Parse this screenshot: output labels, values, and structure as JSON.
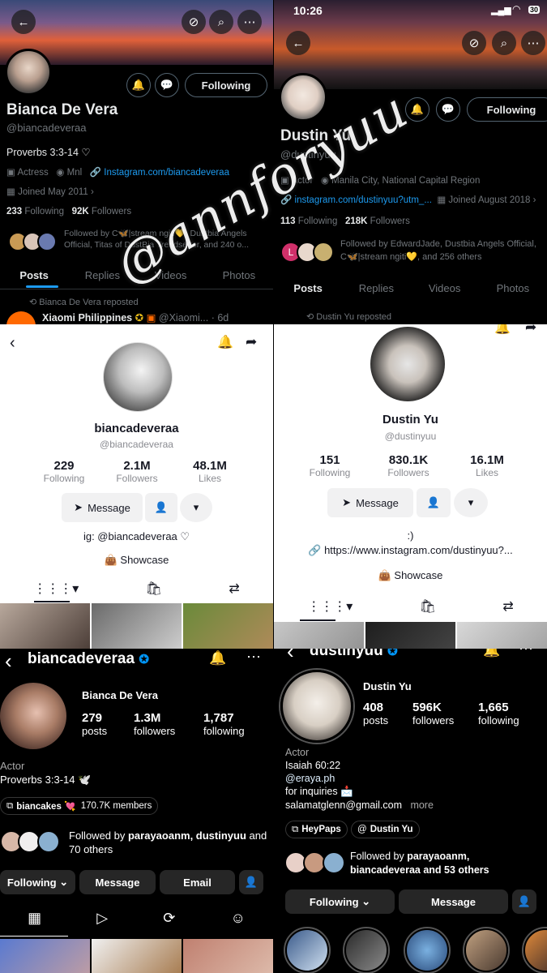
{
  "colors": {
    "x_link": "#1d9bf0",
    "tk_showcase": "#fe2c55",
    "ig_verified": "#0095f6"
  },
  "p1": {
    "back_icon": "arrow-left-icon",
    "following_label": "Following",
    "name": "Bianca De Vera",
    "handle": "@biancadeveraa",
    "bio": "Proverbs 3:3-14 ♡",
    "occupation": "Actress",
    "location": "Mnl",
    "link": "Instagram.com/biancadeveraa",
    "joined": "Joined May 2011",
    "following_count": "233",
    "following_label2": "Following",
    "followers_count": "92K",
    "followers_label": "Followers",
    "followed_by": "Followed by C🦋|stream ngiti💛, Dustbia Angels Official, Titas of DustBia Trendsetter, and 240 o...",
    "tabs": [
      "Posts",
      "Replies",
      "Videos",
      "Photos"
    ],
    "repost_line": "Bianca De Vera reposted",
    "post_author": "Xiaomi Philippines",
    "post_handle": "@Xiaomi...",
    "post_time": "· 6d"
  },
  "p2": {
    "time": "10:26",
    "battery": "30",
    "following_label": "Following",
    "name": "Dustin Yu",
    "handle": "@dustinyuu",
    "occupation": "Actor",
    "location": "Manila City, National Capital Region",
    "link": "instagram.com/dustinyuu?utm_...",
    "joined": "Joined August 2018",
    "following_count": "113",
    "following_label2": "Following",
    "followers_count": "218K",
    "followers_label": "Followers",
    "followed_by": "Followed by EdwardJade, Dustbia Angels Official, C🦋|stream ngiti💛, and 256 others",
    "tabs": [
      "Posts",
      "Replies",
      "Videos",
      "Photos"
    ],
    "repost_line": "Dustin Yu reposted"
  },
  "p3": {
    "username": "biancadeveraa",
    "handle": "@biancadeveraa",
    "stats": [
      {
        "n": "229",
        "l": "Following"
      },
      {
        "n": "2.1M",
        "l": "Followers"
      },
      {
        "n": "48.1M",
        "l": "Likes"
      }
    ],
    "message_label": "Message",
    "bio": "ig: @biancadeveraa ♡",
    "showcase": "Showcase"
  },
  "p4": {
    "name": "Dustin Yu",
    "handle": "@dustinyuu",
    "stats": [
      {
        "n": "151",
        "l": "Following"
      },
      {
        "n": "830.1K",
        "l": "Followers"
      },
      {
        "n": "16.1M",
        "l": "Likes"
      }
    ],
    "message_label": "Message",
    "bio": ":)",
    "link": "https://www.instagram.com/dustinyuu?...",
    "showcase": "Showcase"
  },
  "p5": {
    "username": "biancadeveraa",
    "full_name": "Bianca De Vera",
    "stats": [
      {
        "n": "279",
        "l": "posts"
      },
      {
        "n": "1.3M",
        "l": "followers"
      },
      {
        "n": "1,787",
        "l": "following"
      }
    ],
    "category": "Actor",
    "bio": "Proverbs 3:3-14 🕊️",
    "channel": "biancakes 💘",
    "channel_members": "170.7K members",
    "followed_by_prefix": "Followed by ",
    "followed_by_names": "parayaoanm, dustinyuu",
    "followed_by_suffix": "and 70 others",
    "buttons": [
      "Following",
      "Message",
      "Email"
    ]
  },
  "p6": {
    "username": "dustinyuu",
    "full_name": "Dustin Yu",
    "stats": [
      {
        "n": "408",
        "l": "posts"
      },
      {
        "n": "596K",
        "l": "followers"
      },
      {
        "n": "1,665",
        "l": "following"
      }
    ],
    "category": "Actor",
    "bio1": "Isaiah 60:22",
    "bio_link": "@eraya.ph",
    "bio2": "for inquiries 📩",
    "bio3": "salamatglenn@gmail.com",
    "more": "more",
    "chips": [
      "HeyPaps",
      "Dustin Yu"
    ],
    "followed_by_prefix": "Followed by ",
    "followed_by_names": "parayaoanm, biancadeveraa",
    "followed_by_suffix": " and 53 others",
    "buttons": [
      "Following",
      "Message"
    ]
  },
  "watermark": "@annforyuu"
}
